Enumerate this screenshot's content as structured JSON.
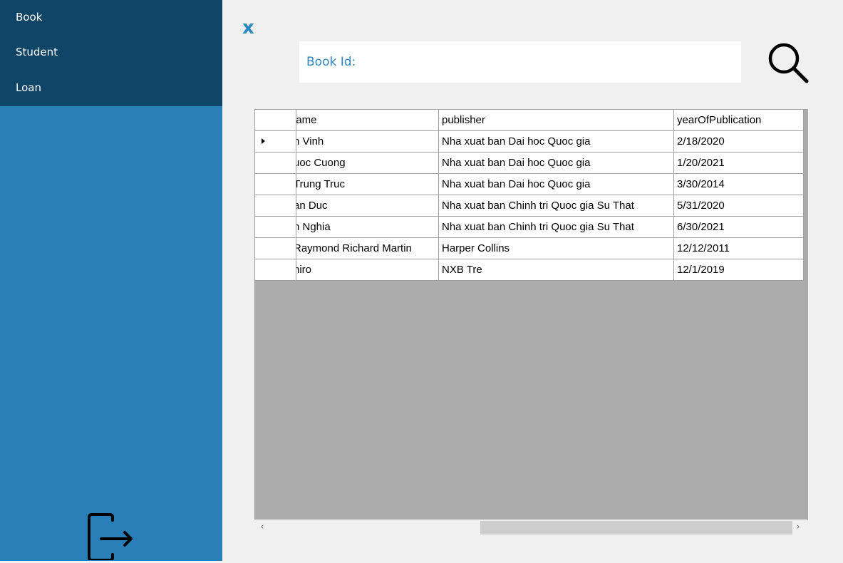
{
  "sidebar": {
    "items": [
      {
        "label": "Book"
      },
      {
        "label": "Student"
      },
      {
        "label": "Loan"
      }
    ],
    "logout_icon": "logout-icon"
  },
  "close_label": "x",
  "search": {
    "label": "Book Id:",
    "value": "",
    "icon": "search-icon"
  },
  "grid": {
    "columns": [
      "lame",
      "publisher",
      "yearOfPublication"
    ],
    "rows": [
      {
        "name": "n Vinh",
        "publisher": "Nha xuat ban Dai hoc Quoc gia",
        "year": "2/18/2020",
        "current": true
      },
      {
        "name": "uoc Cuong",
        "publisher": "Nha xuat ban Dai hoc Quoc gia",
        "year": "1/20/2021",
        "current": false
      },
      {
        "name": "Trung Truc",
        "publisher": "Nha xuat ban Dai hoc Quoc gia",
        "year": "3/30/2014",
        "current": false
      },
      {
        "name": "an Duc",
        "publisher": "Nha xuat ban Chinh tri Quoc gia Su That",
        "year": "5/31/2020",
        "current": false
      },
      {
        "name": "n Nghia",
        "publisher": "Nha xuat ban Chinh tri Quoc gia Su That",
        "year": "6/30/2021",
        "current": false
      },
      {
        "name": "Raymond Richard Martin",
        "publisher": "Harper Collins",
        "year": "12/12/2011",
        "current": false
      },
      {
        "name": "hiro",
        "publisher": "NXB Tre",
        "year": "12/1/2019",
        "current": false
      }
    ],
    "scroll_left": "‹",
    "scroll_right": "›"
  },
  "colors": {
    "sidebar": "#2980b9",
    "menu": "#0f4566",
    "accent": "#2e86c1",
    "grid_empty": "#ababab"
  }
}
